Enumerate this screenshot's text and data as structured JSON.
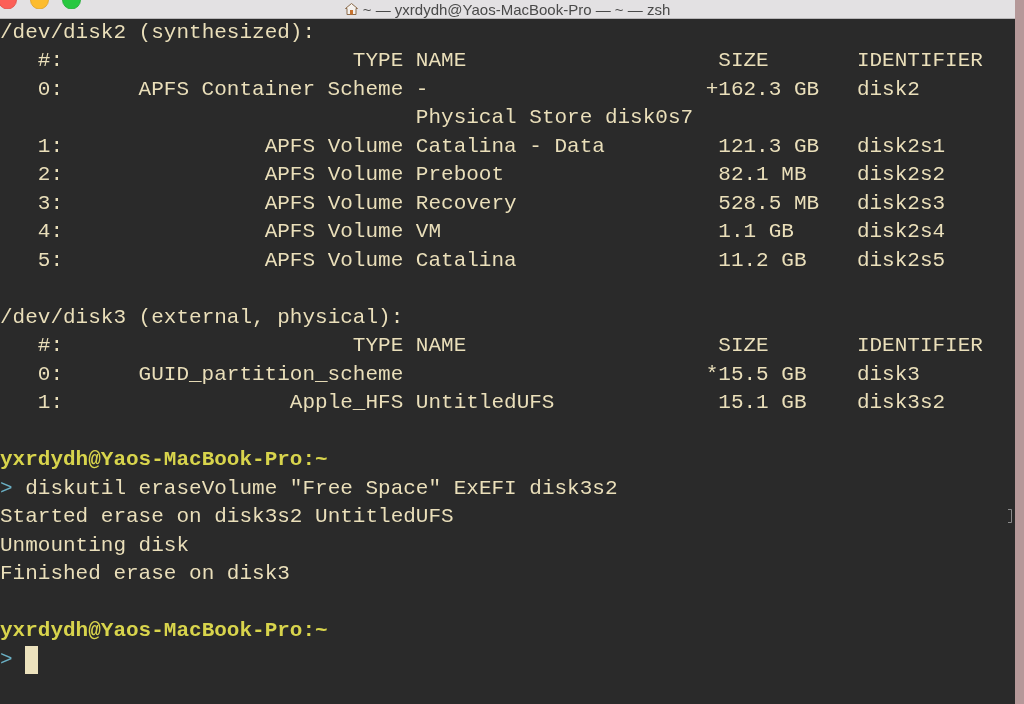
{
  "window": {
    "title": "~ — yxrdydh@Yaos-MacBook-Pro — ~ — zsh"
  },
  "disks": [
    {
      "header": "/dev/disk2 (synthesized):",
      "columns": {
        "index": "#:",
        "type": "TYPE",
        "name": "NAME",
        "size": "SIZE",
        "identifier": "IDENTIFIER"
      },
      "partitions": [
        {
          "index": "0:",
          "type": "APFS Container Scheme",
          "name": "-",
          "size_prefix": "+",
          "size": "162.3 GB",
          "identifier": "disk2",
          "details": "Physical Store disk0s7"
        },
        {
          "index": "1:",
          "type": "APFS Volume",
          "name": "Catalina - Data",
          "size": "121.3 GB",
          "identifier": "disk2s1"
        },
        {
          "index": "2:",
          "type": "APFS Volume",
          "name": "Preboot",
          "size": "82.1 MB",
          "identifier": "disk2s2"
        },
        {
          "index": "3:",
          "type": "APFS Volume",
          "name": "Recovery",
          "size": "528.5 MB",
          "identifier": "disk2s3"
        },
        {
          "index": "4:",
          "type": "APFS Volume",
          "name": "VM",
          "size": "1.1 GB",
          "identifier": "disk2s4"
        },
        {
          "index": "5:",
          "type": "APFS Volume",
          "name": "Catalina",
          "size": "11.2 GB",
          "identifier": "disk2s5"
        }
      ]
    },
    {
      "header": "/dev/disk3 (external, physical):",
      "columns": {
        "index": "#:",
        "type": "TYPE",
        "name": "NAME",
        "size": "SIZE",
        "identifier": "IDENTIFIER"
      },
      "partitions": [
        {
          "index": "0:",
          "type": "GUID_partition_scheme",
          "size_prefix": "*",
          "size": "15.5 GB",
          "identifier": "disk3"
        },
        {
          "index": "1:",
          "type": "Apple_HFS",
          "name": "UntitledUFS",
          "size": "15.1 GB",
          "identifier": "disk3s2"
        }
      ]
    }
  ],
  "sessions": [
    {
      "prompt": "yxrdydh@Yaos-MacBook-Pro:~",
      "symbol": ">",
      "command": "diskutil eraseVolume \"Free Space\" ExEFI disk3s2",
      "output": [
        "Started erase on disk3s2 UntitledUFS",
        "Unmounting disk",
        "Finished erase on disk3"
      ]
    },
    {
      "prompt": "yxrdydh@Yaos-MacBook-Pro:~",
      "symbol": ">",
      "cursor": true
    }
  ]
}
